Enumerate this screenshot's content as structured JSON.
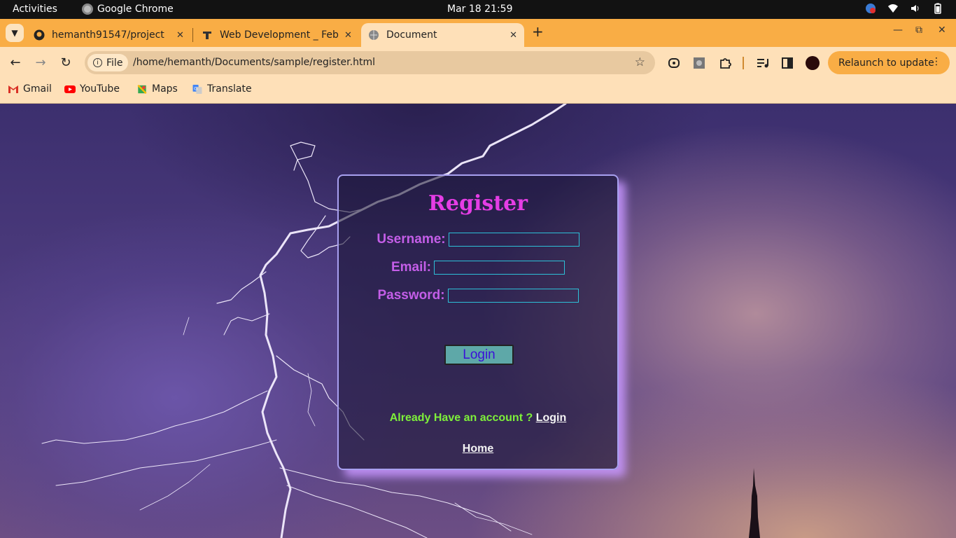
{
  "system_bar": {
    "activities": "Activities",
    "app_name": "Google Chrome",
    "clock": "Mar 18  21:59"
  },
  "tabs": [
    {
      "title": "hemanth91547/project"
    },
    {
      "title": "Web Development _ Feb"
    },
    {
      "title": "Document"
    }
  ],
  "toolbar": {
    "scheme_chip": "File",
    "url": "/home/hemanth/Documents/sample/register.html",
    "relaunch_label": "Relaunch to update"
  },
  "bookmarks": [
    {
      "label": "Gmail"
    },
    {
      "label": "YouTube"
    },
    {
      "label": "Maps"
    },
    {
      "label": "Translate"
    }
  ],
  "form": {
    "title": "Register",
    "username_label": "Username:",
    "email_label": "Email:",
    "password_label": "Password:",
    "login_button": "Login",
    "already_text": "Already Have an account ?",
    "login_link": "Login",
    "home_link": "Home"
  },
  "colors": {
    "chrome_frame": "#f9ad45",
    "toolbar": "#fee0b8",
    "form_title": "#e53de5",
    "form_label": "#c45ee8",
    "input_border": "#2dc0d8",
    "already_text": "#7ef03a",
    "login_button_bg": "#5ea8a8"
  }
}
